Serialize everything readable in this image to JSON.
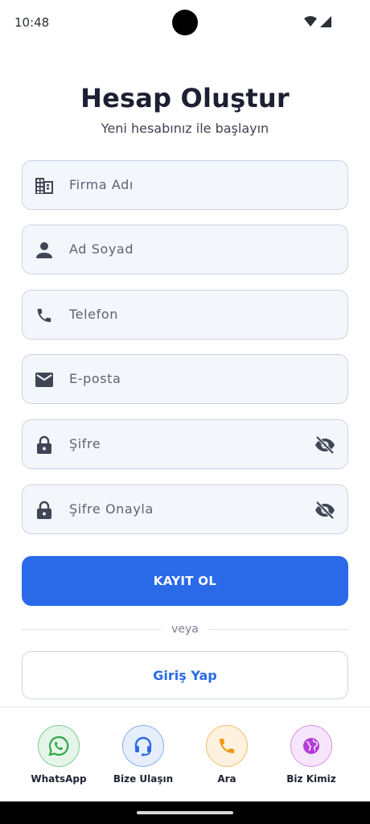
{
  "status_bar": {
    "time": "10:48"
  },
  "header": {
    "title": "Hesap Oluştur",
    "subtitle": "Yeni hesabınız ile başlayın"
  },
  "form": {
    "fields": [
      {
        "placeholder": "Firma Adı",
        "icon": "building-icon"
      },
      {
        "placeholder": "Ad Soyad",
        "icon": "person-icon"
      },
      {
        "placeholder": "Telefon",
        "icon": "phone-icon"
      },
      {
        "placeholder": "E-posta",
        "icon": "email-icon"
      },
      {
        "placeholder": "Şifre",
        "icon": "lock-icon",
        "trailing_icon": "visibility-off-icon"
      },
      {
        "placeholder": "Şifre Onayla",
        "icon": "lock-icon",
        "trailing_icon": "visibility-off-icon"
      }
    ],
    "register_label": "KAYIT OL",
    "divider_text": "veya",
    "login_label": "Giriş Yap"
  },
  "bottom_nav": {
    "items": [
      {
        "label": "WhatsApp",
        "icon": "whatsapp-icon",
        "color": "#2ea84a"
      },
      {
        "label": "Bize Ulaşın",
        "icon": "headset-icon",
        "color": "#2a6ae9"
      },
      {
        "label": "Ara",
        "icon": "phone-icon",
        "color": "#f29a0e"
      },
      {
        "label": "Biz Kimiz",
        "icon": "globe-icon",
        "color": "#b23fd6"
      }
    ]
  },
  "colors": {
    "primary": "#2a6ae9",
    "field_bg": "#f3f6fb",
    "field_border": "#cdd4e0",
    "icon": "#3f4656"
  }
}
